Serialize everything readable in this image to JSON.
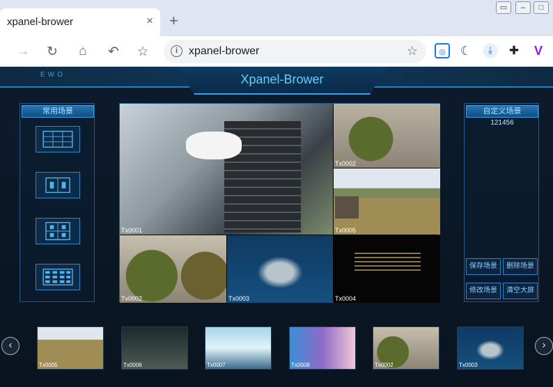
{
  "browser": {
    "tab_title": "xpanel-brower",
    "close_glyph": "×",
    "new_tab_glyph": "+",
    "url": "xpanel-brower",
    "icons": [
      "back-icon",
      "reload-icon",
      "home-icon",
      "undo-icon",
      "bookmark-star-icon",
      "site-info-icon",
      "screenshot-icon",
      "moon-icon",
      "download-icon",
      "extensions-icon",
      "profile-v-icon"
    ]
  },
  "app": {
    "logo": "EWO",
    "title": "Xpanel-Brower",
    "left_panel": {
      "header": "常用场景"
    },
    "right_panel": {
      "header": "自定义场景",
      "scenes": [
        "121456"
      ],
      "buttons": [
        "保存场景",
        "删除场景",
        "修改场景",
        "清空大屏"
      ]
    },
    "video_wall": {
      "cells": [
        {
          "label": "Tx0001"
        },
        {
          "label": "Tx0002"
        },
        {
          "label": "Tx0005"
        },
        {
          "label": "Tx0002"
        },
        {
          "label": "Tx0003"
        },
        {
          "label": "Tx0004"
        }
      ]
    },
    "thumbnails": [
      {
        "label": "Tx0005"
      },
      {
        "label": "Tx0006"
      },
      {
        "label": "Tx0007"
      },
      {
        "label": "Tx0008"
      },
      {
        "label": "Tx0002"
      },
      {
        "label": "Tx0003"
      }
    ],
    "prev_glyph": "‹",
    "next_glyph": "›"
  },
  "colors": {
    "accent": "#2aa8ff",
    "title": "#5fd0ff",
    "bg": "#0b1726"
  }
}
